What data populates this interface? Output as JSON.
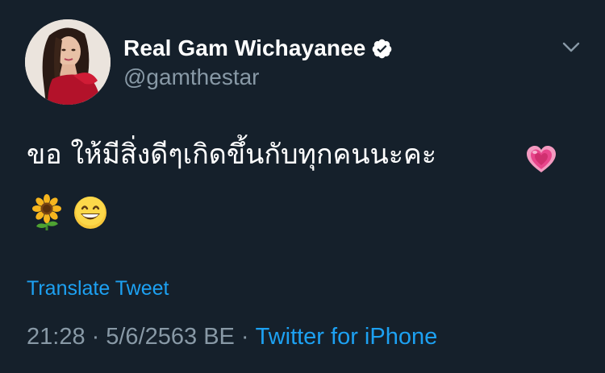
{
  "tweet": {
    "display_name": "Real Gam Wichayanee",
    "handle": "@gamthestar",
    "text": "ขอ ให้มีสิ่งดีๆเกิดขึ้นกับทุกคนนะคะ",
    "emojis": {
      "trailing": "growing-heart",
      "second_line": [
        "sunflower",
        "grinning-face-with-smiling-eyes"
      ]
    },
    "translate_label": "Translate Tweet",
    "time": "21:28",
    "separator": "·",
    "date": "5/6/2563 BE",
    "source": "Twitter for iPhone"
  },
  "icons": {
    "verified": "verified-badge-icon",
    "more": "chevron-down-icon"
  },
  "colors": {
    "background": "#15202b",
    "primary_text": "#ffffff",
    "secondary_text": "#8899a6",
    "accent": "#1da1f2",
    "heart": "#e8458b",
    "sunflower": "#f6b51e"
  }
}
